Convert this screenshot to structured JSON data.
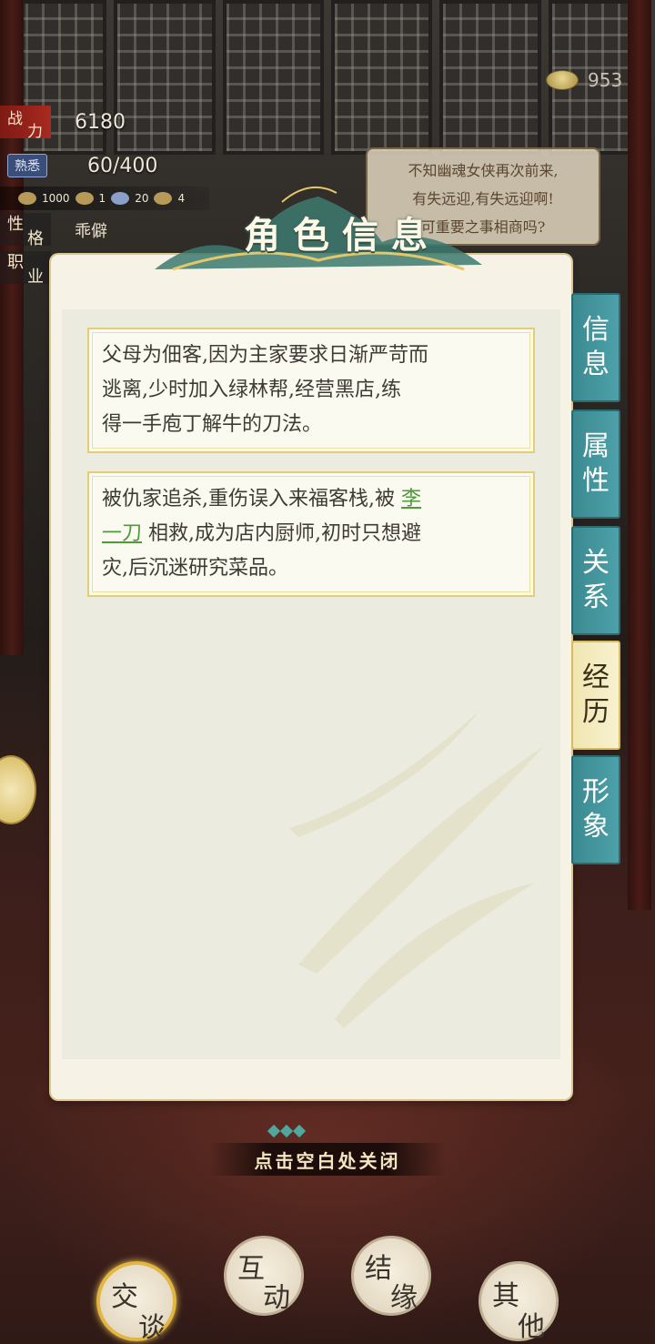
{
  "stats": {
    "power_label_1": "战",
    "power_label_2": "力",
    "power_value": "6180",
    "familiar_label": "熟悉",
    "familiar_value": "60/400",
    "mini": [
      "1000",
      "1",
      "20",
      "4"
    ],
    "personality_label_1": "性",
    "personality_label_2": "格",
    "personality_value": "乖僻",
    "job_label_1": "职",
    "job_label_2": "业"
  },
  "currency": {
    "value": "953",
    "icon": "tea-bowl-icon"
  },
  "speech": {
    "line1": "不知幽魂女侠再次前来,",
    "line2": "有失远迎,有失远迎啊!",
    "line3": "可重要之事相商吗?"
  },
  "panel": {
    "title": "角色信息",
    "card1": {
      "line1": "父母为佃客,因为主家要求日渐严苛而",
      "line2": "逃离,少时加入绿林帮,经营黑店,练",
      "line3": "得一手庖丁解牛的刀法。"
    },
    "card2": {
      "line1_pre": "被仇家追杀,重伤误入来福客栈,被 ",
      "link_part1": "李",
      "link_part2": "一刀",
      "line2_post": " 相救,成为店内厨师,初时只想避",
      "line3": "灾,后沉迷研究菜品。"
    }
  },
  "tabs": [
    {
      "c1": "信",
      "c2": "息",
      "active": false
    },
    {
      "c1": "属",
      "c2": "性",
      "active": false
    },
    {
      "c1": "关",
      "c2": "系",
      "active": false
    },
    {
      "c1": "经",
      "c2": "历",
      "active": true
    },
    {
      "c1": "形",
      "c2": "象",
      "active": false
    }
  ],
  "close_hint": "点击空白处关闭",
  "bottom_buttons": [
    {
      "c1": "交",
      "c2": "谈",
      "active": true
    },
    {
      "c1": "互",
      "c2": "动",
      "active": false
    },
    {
      "c1": "结",
      "c2": "缘",
      "active": false
    },
    {
      "c1": "其",
      "c2": "他",
      "active": false
    }
  ],
  "colors": {
    "tab_teal": "#4da1a8",
    "tab_active": "#f8f1cf",
    "link_green": "#4f9a3d",
    "card_border": "#e5cd73"
  }
}
